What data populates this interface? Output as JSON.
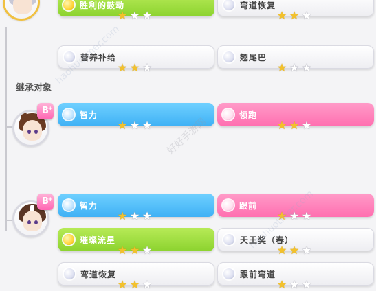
{
  "section": {
    "inherit_label": "继承对象"
  },
  "rank_badge": "B",
  "watermarks": [
    "haohuotmer.com",
    "haohuotmer.com",
    "好好手游网"
  ],
  "colors": {
    "blue": "#3fb1f5",
    "pink": "#ff6fb0",
    "green": "#8cd32f",
    "white": "#ffffff",
    "star_on": "#f3c12b"
  },
  "groups": [
    {
      "rows": [
        {
          "left": {
            "label": "胜利的鼓动",
            "color": "green",
            "stars": 1,
            "max": 3
          },
          "right": {
            "label": "弯道恢复",
            "color": "white",
            "stars": 2,
            "max": 3
          }
        },
        {
          "left": {
            "label": "营养补给",
            "color": "white",
            "stars": 2,
            "max": 3
          },
          "right": {
            "label": "翘尾巴",
            "color": "white",
            "stars": 1,
            "max": 3
          }
        }
      ]
    },
    {
      "rows": [
        {
          "left": {
            "label": "智力",
            "color": "blue",
            "stars": 1,
            "max": 3
          },
          "right": {
            "label": "领跑",
            "color": "pink",
            "stars": 2,
            "max": 3
          }
        }
      ]
    },
    {
      "rows": [
        {
          "left": {
            "label": "智力",
            "color": "blue",
            "stars": 1,
            "max": 3
          },
          "right": {
            "label": "跟前",
            "color": "pink",
            "stars": 1,
            "max": 3
          }
        },
        {
          "left": {
            "label": "璀璨流星",
            "color": "green",
            "stars": 2,
            "max": 3
          },
          "right": {
            "label": "天王奖（春）",
            "color": "white",
            "stars": 2,
            "max": 3
          }
        },
        {
          "left": {
            "label": "弯道恢复",
            "color": "white",
            "stars": 2,
            "max": 3
          },
          "right": {
            "label": "跟前弯道",
            "color": "white",
            "stars": 1,
            "max": 3
          }
        }
      ]
    }
  ]
}
